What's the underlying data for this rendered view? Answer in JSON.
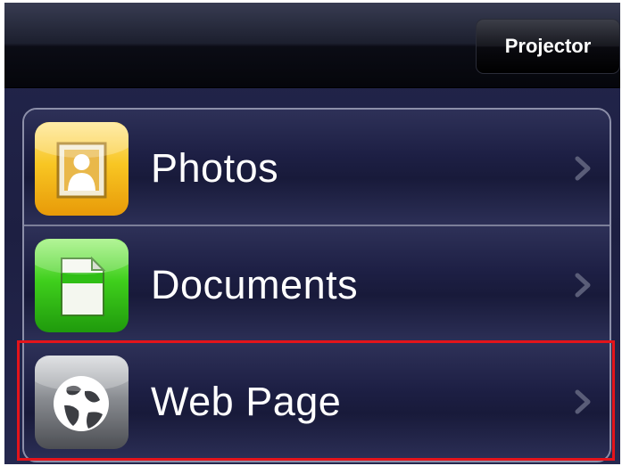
{
  "navbar": {
    "button_label": "Projector"
  },
  "menu": {
    "items": [
      {
        "label": "Photos",
        "icon": "photo-icon"
      },
      {
        "label": "Documents",
        "icon": "document-icon"
      },
      {
        "label": "Web Page",
        "icon": "globe-icon"
      }
    ]
  },
  "colors": {
    "highlight": "#e4141b",
    "photos_icon": "#f6c21a",
    "documents_icon": "#3fcf1c",
    "web_icon": "#8a8d92"
  }
}
